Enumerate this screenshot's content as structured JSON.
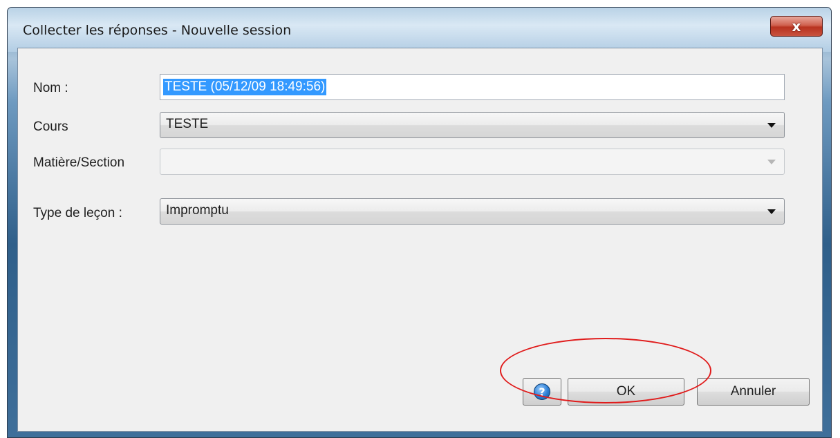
{
  "window": {
    "title": "Collecter les réponses - Nouvelle session",
    "close_label": "x"
  },
  "form": {
    "name_label": "Nom :",
    "name_value": "TESTE (05/12/09 18:49:56)",
    "course_label": "Cours",
    "course_value": "TESTE",
    "subject_label": "Matière/Section",
    "subject_value": "",
    "lesson_type_label": "Type de leçon :",
    "lesson_type_value": "Impromptu"
  },
  "buttons": {
    "help_glyph": "?",
    "ok_label": "OK",
    "cancel_label": "Annuler"
  },
  "colors": {
    "selection": "#3399ff",
    "annotation": "#e01b1b"
  }
}
